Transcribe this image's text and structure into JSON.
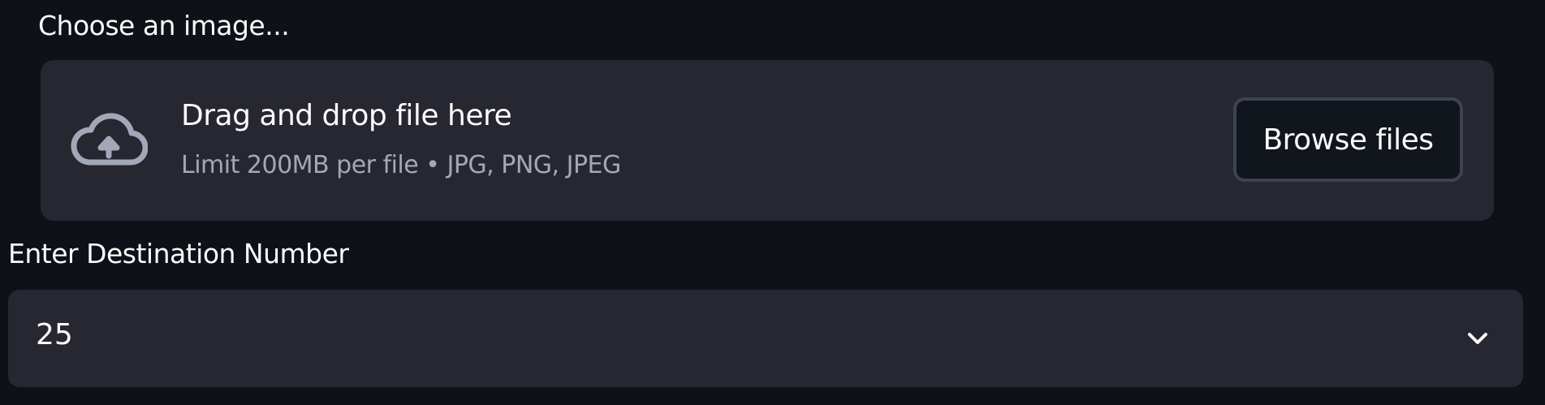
{
  "uploader": {
    "label": "Choose an image...",
    "drop_title": "Drag and drop file here",
    "limit_text": "Limit 200MB per file • JPG, PNG, JPEG",
    "browse_label": "Browse files",
    "icon": "cloud-upload-icon"
  },
  "destination": {
    "label": "Enter Destination Number",
    "selected_value": "25",
    "icon": "chevron-down-icon"
  },
  "colors": {
    "background": "#0e1117",
    "panel": "#262730",
    "text": "#fafafa",
    "muted_text": "#a3a8b8",
    "button_border": "#3f4350"
  }
}
